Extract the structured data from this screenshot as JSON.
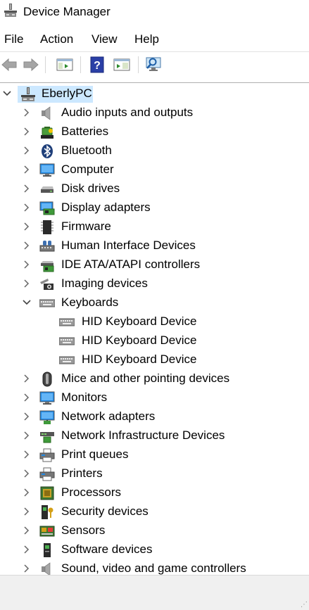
{
  "window": {
    "title": "Device Manager"
  },
  "menu": [
    "File",
    "Action",
    "View",
    "Help"
  ],
  "toolbar": {
    "buttons": [
      "back-arrow-icon",
      "forward-arrow-icon",
      "show-hide-console-tree-icon",
      "help-icon",
      "properties-icon",
      "scan-hardware-icon"
    ]
  },
  "tree": {
    "root": {
      "label": "EberlyPC",
      "icon": "computer-network-icon",
      "expanded": true
    },
    "categories": [
      {
        "label": "Audio inputs and outputs",
        "icon": "speaker-icon",
        "expanded": false
      },
      {
        "label": "Batteries",
        "icon": "battery-icon",
        "expanded": false
      },
      {
        "label": "Bluetooth",
        "icon": "bluetooth-icon",
        "expanded": false
      },
      {
        "label": "Computer",
        "icon": "monitor-icon",
        "expanded": false
      },
      {
        "label": "Disk drives",
        "icon": "disk-drive-icon",
        "expanded": false
      },
      {
        "label": "Display adapters",
        "icon": "display-adapter-icon",
        "expanded": false
      },
      {
        "label": "Firmware",
        "icon": "firmware-chip-icon",
        "expanded": false
      },
      {
        "label": "Human Interface Devices",
        "icon": "hid-icon",
        "expanded": false
      },
      {
        "label": "IDE ATA/ATAPI controllers",
        "icon": "ide-controller-icon",
        "expanded": false
      },
      {
        "label": "Imaging devices",
        "icon": "camera-icon",
        "expanded": false
      },
      {
        "label": "Keyboards",
        "icon": "keyboard-icon",
        "expanded": true,
        "children": [
          {
            "label": "HID Keyboard Device",
            "icon": "keyboard-icon"
          },
          {
            "label": "HID Keyboard Device",
            "icon": "keyboard-icon"
          },
          {
            "label": "HID Keyboard Device",
            "icon": "keyboard-icon"
          }
        ]
      },
      {
        "label": "Mice and other pointing devices",
        "icon": "mouse-icon",
        "expanded": false
      },
      {
        "label": "Monitors",
        "icon": "monitor-icon",
        "expanded": false
      },
      {
        "label": "Network adapters",
        "icon": "network-adapter-icon",
        "expanded": false
      },
      {
        "label": "Network Infrastructure Devices",
        "icon": "network-infrastructure-icon",
        "expanded": false
      },
      {
        "label": "Print queues",
        "icon": "printer-icon",
        "expanded": false
      },
      {
        "label": "Printers",
        "icon": "printer-icon",
        "expanded": false
      },
      {
        "label": "Processors",
        "icon": "processor-icon",
        "expanded": false
      },
      {
        "label": "Security devices",
        "icon": "security-key-icon",
        "expanded": false
      },
      {
        "label": "Sensors",
        "icon": "sensor-icon",
        "expanded": false
      },
      {
        "label": "Software devices",
        "icon": "software-device-icon",
        "expanded": false
      },
      {
        "label": "Sound, video and game controllers",
        "icon": "speaker-icon",
        "expanded": false
      }
    ]
  },
  "colors": {
    "selection": "#cce8ff",
    "accent": "#1e7ad6"
  }
}
